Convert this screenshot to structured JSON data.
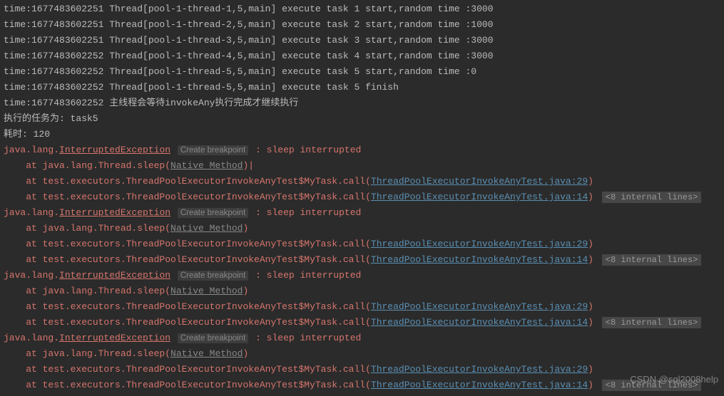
{
  "logs": [
    "time:1677483602251 Thread[pool-1-thread-1,5,main] execute task 1 start,random time :3000",
    "time:1677483602251 Thread[pool-1-thread-2,5,main] execute task 2 start,random time :1000",
    "time:1677483602251 Thread[pool-1-thread-3,5,main] execute task 3 start,random time :3000",
    "time:1677483602252 Thread[pool-1-thread-4,5,main] execute task 4 start,random time :3000",
    "time:1677483602252 Thread[pool-1-thread-5,5,main] execute task 5 start,random time :0",
    "time:1677483602252 Thread[pool-1-thread-5,5,main] execute task 5 finish",
    "time:1677483602252 主线程会等待invokeAny执行完成才继续执行",
    "执行的任务为: task5",
    "耗时: 120"
  ],
  "ex": {
    "pkg": "java.lang.",
    "name": "InterruptedException",
    "bp": "Create breakpoint",
    "msg": " : sleep interrupted",
    "at": "at ",
    "f1a": "java.lang.Thread.sleep(",
    "f1b": "Native Method",
    "f1c": ")",
    "f2a": "at test.executors.ThreadPoolExecutorInvokeAnyTest$MyTask.call(",
    "f2b": "ThreadPoolExecutorInvokeAnyTest.java:29",
    "f2c": ")",
    "f3a": "at test.executors.ThreadPoolExecutorInvokeAnyTest$MyTask.call(",
    "f3b": "ThreadPoolExecutorInvokeAnyTest.java:14",
    "f3c": ")",
    "int": "<8 internal lines>"
  },
  "watermark": "CSDN @sql2008help"
}
